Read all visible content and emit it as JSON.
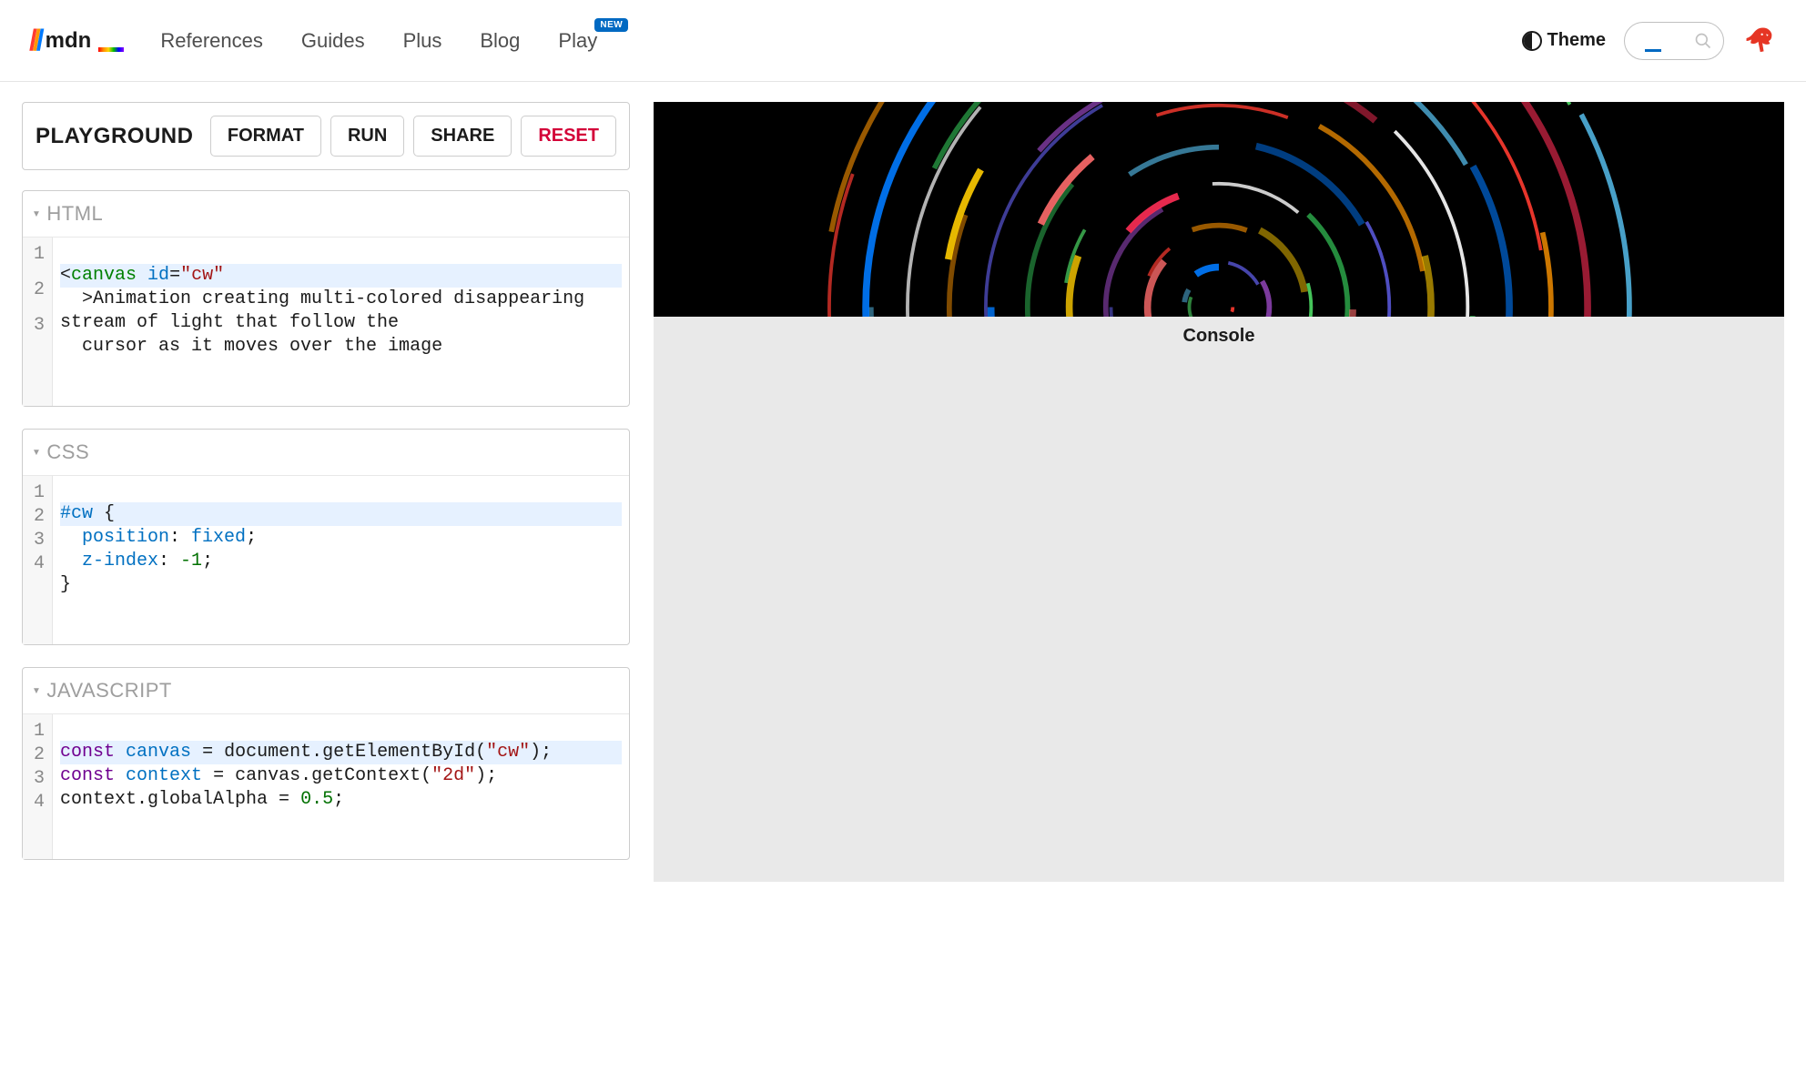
{
  "header": {
    "logo_text": "mdn",
    "nav": {
      "references": "References",
      "guides": "Guides",
      "plus": "Plus",
      "blog": "Blog",
      "play": "Play",
      "play_badge": "NEW"
    },
    "theme_label": "Theme",
    "search_placeholder": ""
  },
  "toolbar": {
    "title": "PLAYGROUND",
    "format": "FORMAT",
    "run": "RUN",
    "share": "SHARE",
    "reset": "RESET"
  },
  "panels": {
    "html": {
      "label": "HTML",
      "gutter": [
        "1",
        "2",
        "3"
      ],
      "lines": {
        "l1_open": "<",
        "l1_tag": "canvas",
        "l1_sp": " ",
        "l1_attr": "id",
        "l1_eq": "=",
        "l1_str": "\"cw\"",
        "l2": "  >Animation creating multi-colored disappearing stream of light that follow the ",
        "l3": "  cursor as it moves over the image"
      }
    },
    "css": {
      "label": "CSS",
      "gutter": [
        "1",
        "2",
        "3",
        "4"
      ],
      "lines": {
        "l1_sel": "#cw",
        "l1_sp": " ",
        "l1_brace": "{",
        "l2_prop": "  position",
        "l2_colon": ": ",
        "l2_val": "fixed",
        "l2_semi": ";",
        "l3_prop": "  z-index",
        "l3_colon": ": ",
        "l3_val": "-1",
        "l3_semi": ";",
        "l4": "}"
      }
    },
    "js": {
      "label": "JAVASCRIPT",
      "gutter": [
        "1",
        "2",
        "3",
        "4"
      ],
      "lines": {
        "l1_kw": "const",
        "l1_sp1": " ",
        "l1_var": "canvas",
        "l1_sp2": " ",
        "l1_eq": "=",
        "l1_sp3": " ",
        "l1_rest": "document.getElementById(",
        "l1_str": "\"cw\"",
        "l1_end": ");",
        "l2_kw": "const",
        "l2_sp1": " ",
        "l2_var": "context",
        "l2_sp2": " ",
        "l2_eq": "=",
        "l2_sp3": " ",
        "l2_rest": "canvas.getContext(",
        "l2_str": "\"2d\"",
        "l2_end": ");",
        "l3_a": "context.globalAlpha ",
        "l3_eq": "=",
        "l3_sp": " ",
        "l3_num": "0.5",
        "l3_semi": ";",
        "l4": ""
      }
    }
  },
  "output": {
    "console_label": "Console"
  }
}
